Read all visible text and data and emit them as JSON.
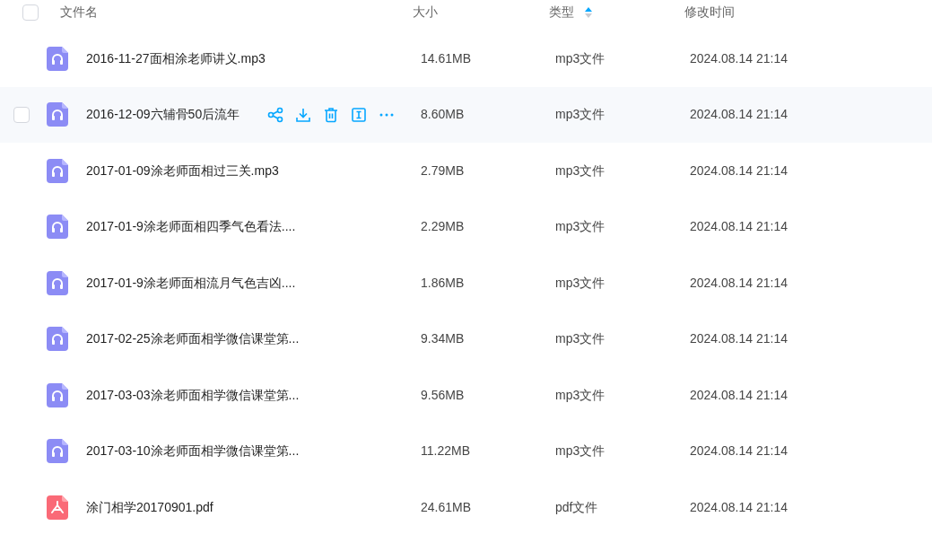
{
  "header": {
    "checked": false,
    "columns": [
      {
        "label": "文件名",
        "sortable": false
      },
      {
        "label": "大小",
        "sortable": false
      },
      {
        "label": "类型",
        "sortable": true,
        "ascending": true
      },
      {
        "label": "修改时间",
        "sortable": false
      }
    ]
  },
  "rows": [
    {
      "kind": "audio",
      "name": "2016-11-27面相涂老师讲义.mp3",
      "size": "14.61MB",
      "type": "mp3文件",
      "modified": "2024.08.14 21:14",
      "hovered": false
    },
    {
      "kind": "audio",
      "name": "2016-12-09六辅骨50后流年",
      "size": "8.60MB",
      "type": "mp3文件",
      "modified": "2024.08.14 21:14",
      "hovered": true
    },
    {
      "kind": "audio",
      "name": "2017-01-09涂老师面相过三关.mp3",
      "size": "2.79MB",
      "type": "mp3文件",
      "modified": "2024.08.14 21:14",
      "hovered": false
    },
    {
      "kind": "audio",
      "name": "2017-01-9涂老师面相四季气色看法....",
      "size": "2.29MB",
      "type": "mp3文件",
      "modified": "2024.08.14 21:14",
      "hovered": false
    },
    {
      "kind": "audio",
      "name": "2017-01-9涂老师面相流月气色吉凶....",
      "size": "1.86MB",
      "type": "mp3文件",
      "modified": "2024.08.14 21:14",
      "hovered": false
    },
    {
      "kind": "audio",
      "name": "2017-02-25涂老师面相学微信课堂第...",
      "size": "9.34MB",
      "type": "mp3文件",
      "modified": "2024.08.14 21:14",
      "hovered": false
    },
    {
      "kind": "audio",
      "name": "2017-03-03涂老师面相学微信课堂第...",
      "size": "9.56MB",
      "type": "mp3文件",
      "modified": "2024.08.14 21:14",
      "hovered": false
    },
    {
      "kind": "audio",
      "name": "2017-03-10涂老师面相学微信课堂第...",
      "size": "11.22MB",
      "type": "mp3文件",
      "modified": "2024.08.14 21:14",
      "hovered": false
    },
    {
      "kind": "pdf",
      "name": "涂门相学20170901.pdf",
      "size": "24.61MB",
      "type": "pdf文件",
      "modified": "2024.08.14 21:14",
      "hovered": false
    }
  ]
}
